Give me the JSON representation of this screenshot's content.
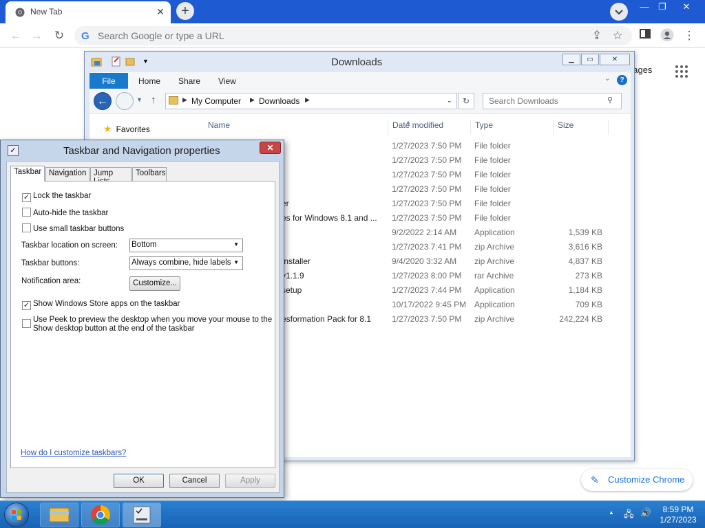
{
  "chrome": {
    "tab_title": "New Tab",
    "tab_close": "✕",
    "new_tab": "+",
    "window_controls": {
      "minimize": "—",
      "maximize": "❐",
      "close": "✕"
    },
    "omnibox_placeholder": "Search Google or type a URL",
    "google_glyph": "G",
    "ntp_images_text": "nages",
    "customize_chrome_label": "Customize Chrome",
    "icons": [
      "back-arrow-icon",
      "forward-arrow-icon",
      "reload-icon",
      "share-icon",
      "star-icon",
      "side-panel-icon",
      "profile-icon",
      "menu-icon",
      "apps-grid-icon",
      "pencil-icon"
    ]
  },
  "explorer": {
    "title": "Downloads",
    "ribbon_tabs": {
      "file": "File",
      "home": "Home",
      "share": "Share",
      "view": "View"
    },
    "help": "?",
    "breadcrumb": [
      "My Computer",
      "Downloads"
    ],
    "search_placeholder": "Search Downloads",
    "favorites_label": "Favorites",
    "columns": {
      "name": "Name",
      "date": "Date modified",
      "type": "Type",
      "size": "Size"
    },
    "rows": [
      {
        "name": "",
        "date": "1/27/2023 7:50 PM",
        "type": "File folder",
        "size": ""
      },
      {
        "name": "",
        "date": "1/27/2023 7:50 PM",
        "type": "File folder",
        "size": ""
      },
      {
        "name": "",
        "date": "1/27/2023 7:50 PM",
        "type": "File folder",
        "size": ""
      },
      {
        "name": "",
        "date": "1/27/2023 7:50 PM",
        "type": "File folder",
        "size": ""
      },
      {
        "name": "er",
        "date": "1/27/2023 7:50 PM",
        "type": "File folder",
        "size": ""
      },
      {
        "name": "es for Windows 8.1 and ...",
        "date": "1/27/2023 7:50 PM",
        "type": "File folder",
        "size": ""
      },
      {
        "name": "",
        "date": "9/2/2022 2:14 AM",
        "type": "Application",
        "size": "1,539 KB"
      },
      {
        "name": "",
        "date": "1/27/2023 7:41 PM",
        "type": "zip Archive",
        "size": "3,616 KB"
      },
      {
        "name": "Installer",
        "date": "9/4/2020 3:32 AM",
        "type": "zip Archive",
        "size": "4,837 KB"
      },
      {
        "name": "v1.1.9",
        "date": "1/27/2023 8:00 PM",
        "type": "rar Archive",
        "size": "273 KB"
      },
      {
        "name": "setup",
        "date": "1/27/2023 7:44 PM",
        "type": "Application",
        "size": "1,184 KB"
      },
      {
        "name": "",
        "date": "10/17/2022 9:45 PM",
        "type": "Application",
        "size": "709 KB"
      },
      {
        "name": "esformation Pack for 8.1",
        "date": "1/27/2023 7:50 PM",
        "type": "zip Archive",
        "size": "242,224 KB"
      }
    ]
  },
  "dialog": {
    "title": "Taskbar and Navigation properties",
    "close": "✕",
    "tabs": [
      "Taskbar",
      "Navigation",
      "Jump Lists",
      "Toolbars"
    ],
    "checkboxes": [
      {
        "label": "Lock the taskbar",
        "checked": "✓"
      },
      {
        "label": "Auto-hide the taskbar",
        "checked": ""
      },
      {
        "label": "Use small taskbar buttons",
        "checked": ""
      },
      {
        "label": "Show Windows Store apps on the taskbar",
        "checked": "✓"
      },
      {
        "label": "Use Peek to preview the desktop when you move your mouse to the",
        "label2": "Show desktop button at the end of the taskbar",
        "checked": ""
      }
    ],
    "location_label": "Taskbar location on screen:",
    "location_value": "Bottom",
    "buttons_label": "Taskbar buttons:",
    "buttons_value": "Always combine, hide labels",
    "notification_label": "Notification area:",
    "customize_btn": "Customize...",
    "help_link": "How do I customize taskbars?",
    "ok": "OK",
    "cancel": "Cancel",
    "apply": "Apply"
  },
  "taskbar": {
    "time": "8:59 PM",
    "date": "1/27/2023",
    "icons": [
      "start-orb-icon",
      "file-explorer-icon",
      "chrome-icon",
      "properties-window-icon",
      "tray-expand-icon",
      "network-icon",
      "volume-icon"
    ]
  }
}
